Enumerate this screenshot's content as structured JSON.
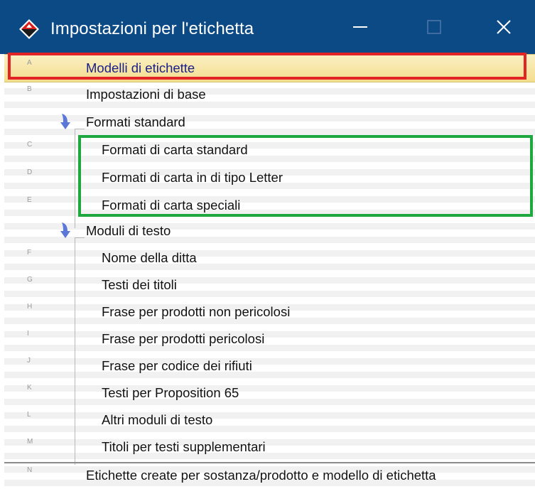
{
  "window": {
    "title": "Impostazioni per l'etichetta",
    "controls": [
      "minimize",
      "maximize",
      "close"
    ]
  },
  "tree": [
    {
      "letter": "A",
      "label": "Modelli di etichette",
      "level": 0,
      "selected": true
    },
    {
      "letter": "B",
      "label": "Impostazioni di base",
      "level": 0
    },
    {
      "letter": "",
      "label": "Formati standard",
      "level": 0,
      "expandable": true
    },
    {
      "letter": "C",
      "label": "Formati di carta standard",
      "level": 1
    },
    {
      "letter": "D",
      "label": "Formati di carta in di tipo Letter",
      "level": 1
    },
    {
      "letter": "E",
      "label": "Formati di carta speciali",
      "level": 1
    },
    {
      "letter": "",
      "label": "Moduli di testo",
      "level": 0,
      "expandable": true
    },
    {
      "letter": "F",
      "label": "Nome della ditta",
      "level": 1
    },
    {
      "letter": "G",
      "label": "Testi dei titoli",
      "level": 1
    },
    {
      "letter": "H",
      "label": "Frase per prodotti non pericolosi",
      "level": 1
    },
    {
      "letter": "I",
      "label": "Frase per prodotti pericolosi",
      "level": 1
    },
    {
      "letter": "J",
      "label": "Frase per codice dei rifiuti",
      "level": 1
    },
    {
      "letter": "K",
      "label": "Testi per Proposition 65",
      "level": 1
    },
    {
      "letter": "L",
      "label": "Altri moduli di testo",
      "level": 1
    },
    {
      "letter": "M",
      "label": "Titoli per testi supplementari",
      "level": 1
    },
    {
      "letter": "N",
      "label": "Etichette create per sostanza/prodotto e modello di etichetta",
      "level": 0
    }
  ],
  "colors": {
    "titlebar": "#0c4a86",
    "selection": "#f3dd8d",
    "highlight_red": "#e32424",
    "highlight_green": "#20a840",
    "expand_arrow": "#5b78d8"
  }
}
